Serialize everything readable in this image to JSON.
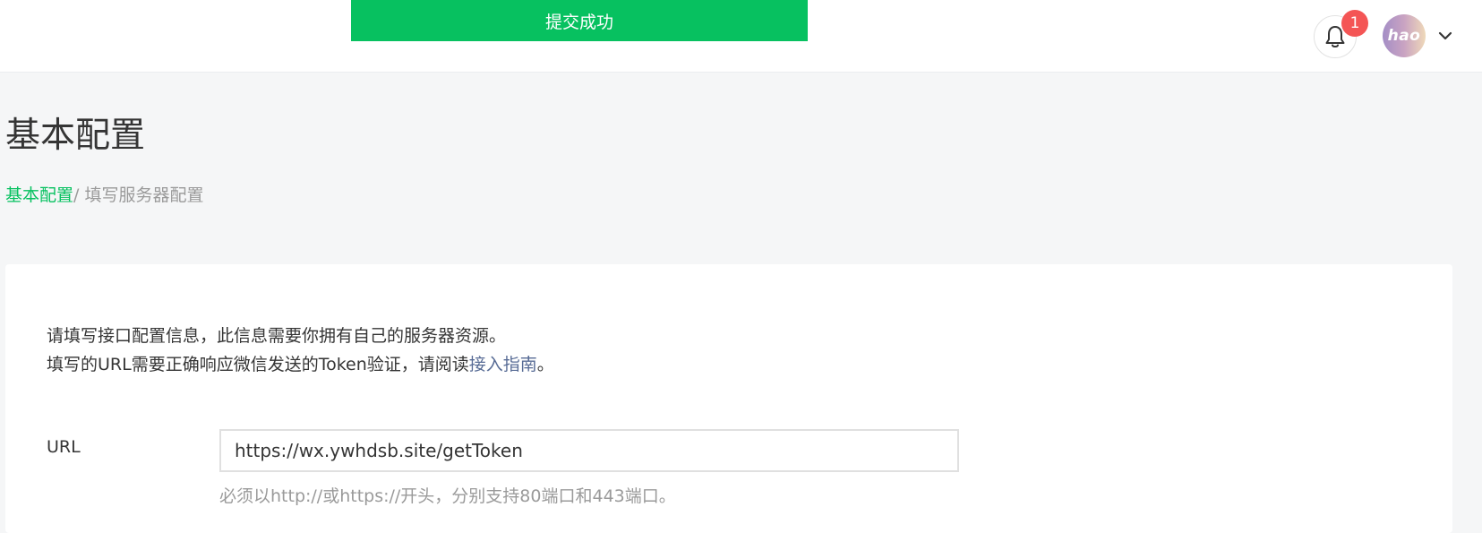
{
  "toast": {
    "message": "提交成功",
    "color": "#07c160"
  },
  "header": {
    "notifications": {
      "icon": "bell-icon",
      "count": "1"
    },
    "user": {
      "avatar_text": "hao",
      "menu_icon": "chevron-down-icon"
    }
  },
  "page": {
    "title": "基本配置",
    "breadcrumb": {
      "root": "基本配置",
      "current": "/ 填写服务器配置"
    }
  },
  "form": {
    "intro_line1": "请填写接口配置信息，此信息需要你拥有自己的服务器资源。",
    "intro_line2_prefix": "填写的URL需要正确响应微信发送的Token验证，请阅读",
    "intro_link": "接入指南",
    "intro_line2_suffix": "。",
    "url": {
      "label": "URL",
      "value": "https://wx.ywhdsb.site/getToken",
      "hint": "必须以http://或https://开头，分别支持80端口和443端口。"
    }
  },
  "colors": {
    "accent": "#07c160",
    "link": "#576b95",
    "badge": "#f45555"
  }
}
